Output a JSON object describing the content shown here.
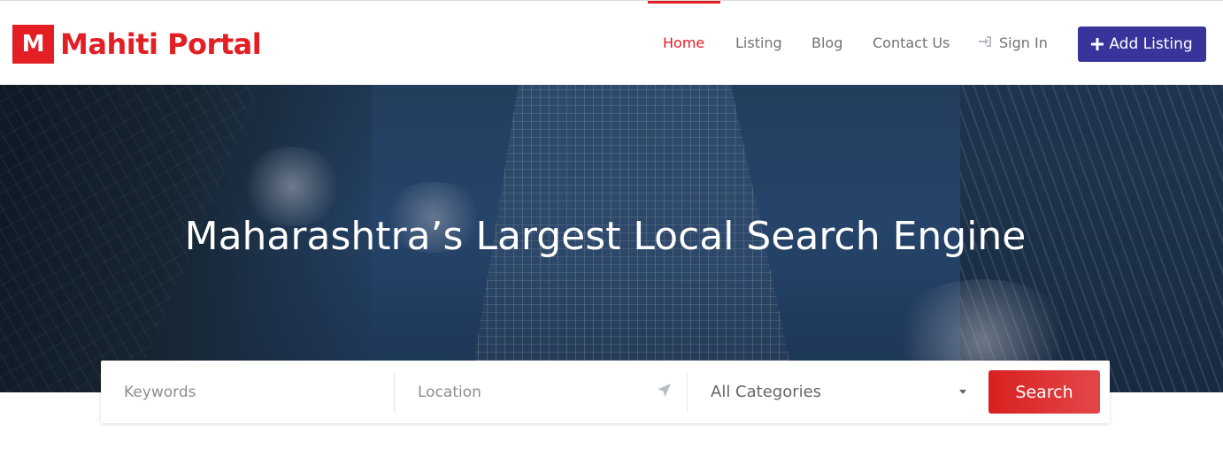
{
  "brand": {
    "badge": "M",
    "name": "Mahiti Portal",
    "color": "#e31e24"
  },
  "nav": {
    "items": [
      {
        "label": "Home",
        "active": true
      },
      {
        "label": "Listing"
      },
      {
        "label": "Blog"
      },
      {
        "label": "Contact Us"
      },
      {
        "label": "Sign In",
        "icon": "sign-in-icon"
      }
    ],
    "add_listing": {
      "label": "Add Listing",
      "icon": "plus-icon",
      "color": "#38349c"
    }
  },
  "hero": {
    "title": "Maharashtra’s Largest Local Search Engine"
  },
  "search": {
    "keywords_placeholder": "Keywords",
    "location_placeholder": "Location",
    "location_icon": "location-arrow-icon",
    "category_selected": "All Categories",
    "button_label": "Search",
    "button_color": "#d8201f"
  }
}
